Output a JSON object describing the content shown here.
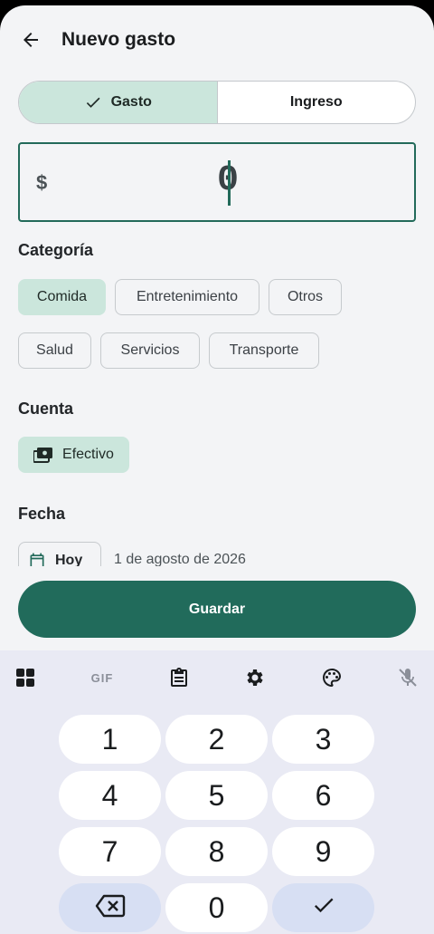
{
  "appbar": {
    "title": "Nuevo gasto",
    "back_icon": "arrow-left-icon"
  },
  "type_toggle": {
    "options": [
      {
        "label": "Gasto",
        "selected": true
      },
      {
        "label": "Ingreso",
        "selected": false
      }
    ]
  },
  "amount": {
    "currency": "$",
    "value": "0"
  },
  "category": {
    "title": "Categoría",
    "chips": [
      {
        "label": "Comida",
        "selected": true
      },
      {
        "label": "Entretenimiento",
        "selected": false
      },
      {
        "label": "Otros",
        "selected": false
      },
      {
        "label": "Salud",
        "selected": false
      },
      {
        "label": "Servicios",
        "selected": false
      },
      {
        "label": "Transporte",
        "selected": false
      }
    ]
  },
  "account": {
    "title": "Cuenta",
    "selected": "Efectivo",
    "icon": "cash-icon"
  },
  "date": {
    "title": "Fecha",
    "chip_label": "Hoy",
    "value": "1 de agosto de 2026",
    "icon": "calendar-icon"
  },
  "save": {
    "label": "Guardar"
  },
  "keyboard": {
    "toolbar": [
      "apps-icon",
      "GIF",
      "clipboard-icon",
      "settings-icon",
      "palette-icon",
      "mic-off-icon"
    ],
    "keys": [
      "1",
      "2",
      "3",
      "4",
      "5",
      "6",
      "7",
      "8",
      "9",
      "0"
    ]
  },
  "colors": {
    "primary": "#216b5b",
    "selected_chip": "#cbe6dc",
    "background": "#f3f4f6",
    "keyboard_bg": "#e9eaf4"
  }
}
